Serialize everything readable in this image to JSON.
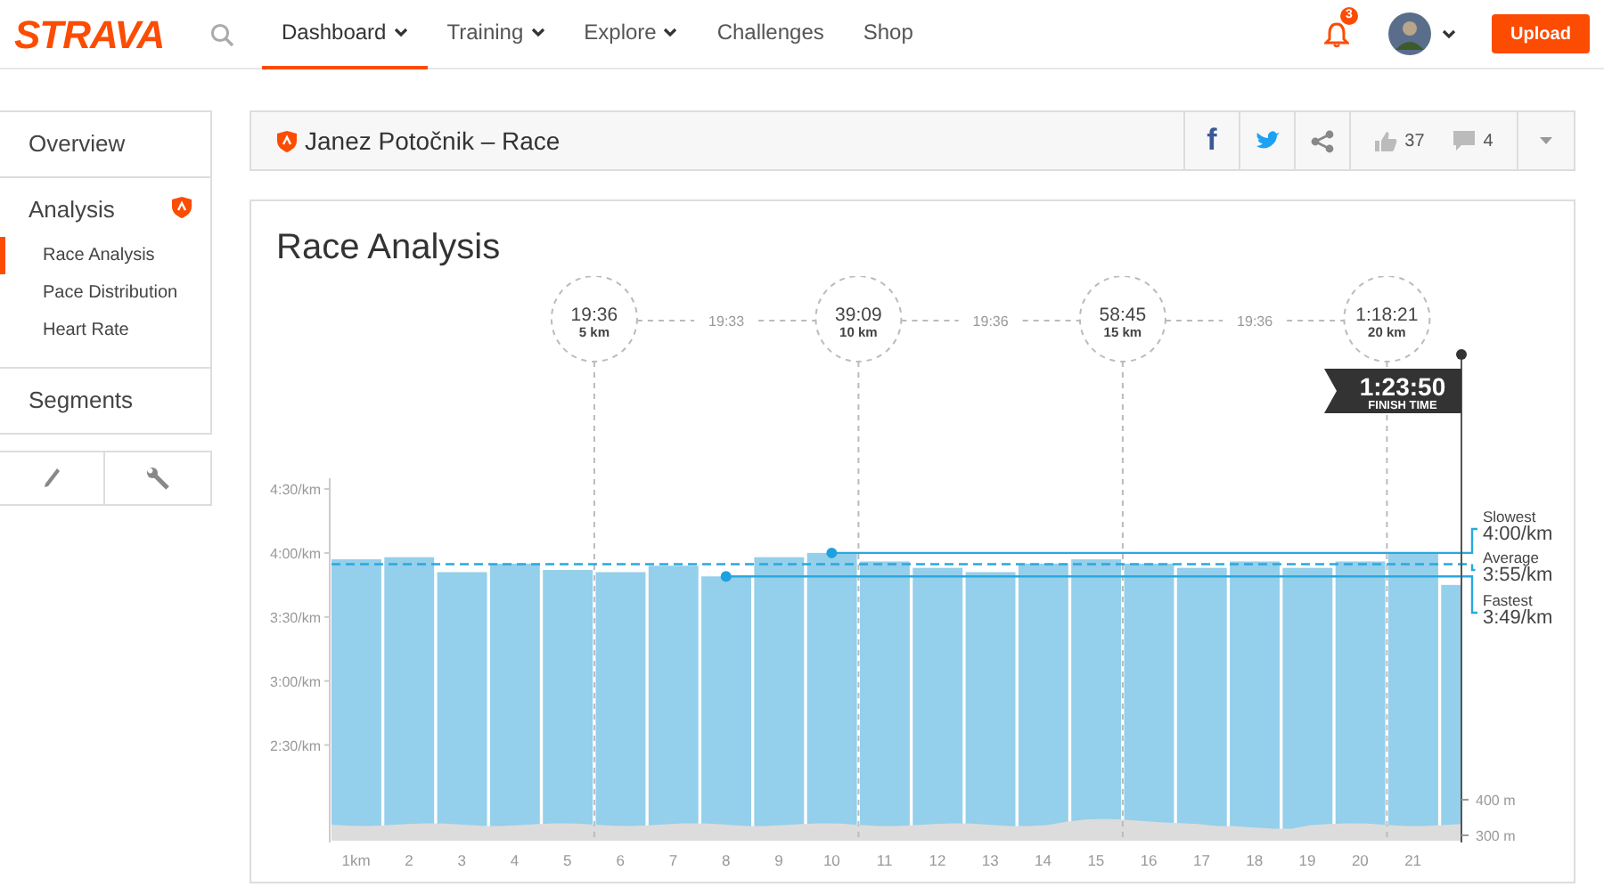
{
  "nav": {
    "logo": "STRAVA",
    "items": [
      {
        "label": "Dashboard",
        "selected": true,
        "dropdown": true
      },
      {
        "label": "Training",
        "selected": false,
        "dropdown": true
      },
      {
        "label": "Explore",
        "selected": false,
        "dropdown": true
      },
      {
        "label": "Challenges",
        "selected": false,
        "dropdown": false
      },
      {
        "label": "Shop",
        "selected": false,
        "dropdown": false
      }
    ],
    "notifications": "3",
    "upload": "Upload"
  },
  "sidebar": {
    "sections": [
      {
        "label": "Overview",
        "premium": false
      },
      {
        "label": "Analysis",
        "premium": true,
        "children": [
          {
            "label": "Race Analysis",
            "selected": true
          },
          {
            "label": "Pace Distribution",
            "selected": false
          },
          {
            "label": "Heart Rate",
            "selected": false
          }
        ]
      },
      {
        "label": "Segments",
        "premium": false
      }
    ]
  },
  "header": {
    "title": "Janez Potočnik – Race",
    "facebook": "f",
    "kudos": "37",
    "comments": "4"
  },
  "analysis": {
    "title": "Race Analysis",
    "splits": [
      {
        "time": "19:36",
        "distance": "5 km"
      },
      {
        "time": "39:09",
        "distance": "10 km"
      },
      {
        "time": "58:45",
        "distance": "15 km"
      },
      {
        "time": "1:18:21",
        "distance": "20 km"
      }
    ],
    "split_intervals": [
      "19:33",
      "19:36",
      "19:36"
    ],
    "finish": {
      "time": "1:23:50",
      "label": "FINISH TIME"
    },
    "pace_markers": [
      {
        "kind": "slowest",
        "label": "Slowest",
        "value": "4:00/km"
      },
      {
        "kind": "average",
        "label": "Average",
        "value": "3:55/km"
      },
      {
        "kind": "fastest",
        "label": "Fastest",
        "value": "3:49/km"
      }
    ],
    "elevation_ticks": [
      "400 m",
      "300 m"
    ],
    "pace_axis_labels": [
      "4:30/km",
      "4:00/km",
      "3:30/km",
      "3:00/km",
      "2:30/km"
    ],
    "km_labels": [
      "1km",
      "2",
      "3",
      "4",
      "5",
      "6",
      "7",
      "8",
      "9",
      "10",
      "11",
      "12",
      "13",
      "14",
      "15",
      "16",
      "17",
      "18",
      "19",
      "20",
      "21"
    ]
  }
}
